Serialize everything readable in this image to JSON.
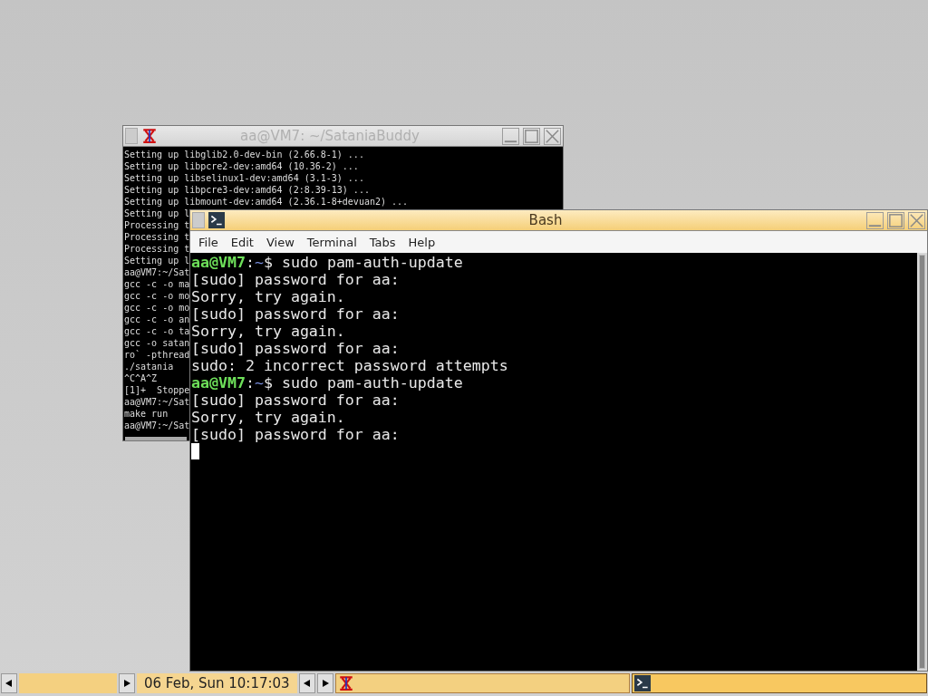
{
  "windows": [
    {
      "title": "aa@VM7: ~/SataniaBuddy",
      "active": false,
      "kind": "xterm",
      "lines": [
        {
          "kind": "output",
          "text": "Setting up libglib2.0-dev-bin (2.66.8-1) ..."
        },
        {
          "kind": "output",
          "text": "Setting up libpcre2-dev:amd64 (10.36-2) ..."
        },
        {
          "kind": "output",
          "text": "Setting up libselinux1-dev:amd64 (3.1-3) ..."
        },
        {
          "kind": "output",
          "text": "Setting up libpcre3-dev:amd64 (2:8.39-13) ..."
        },
        {
          "kind": "output",
          "text": "Setting up libmount-dev:amd64 (2.36.1-8+devuan2) ..."
        },
        {
          "kind": "output",
          "text": "Setting up l"
        },
        {
          "kind": "output",
          "text": "Processing t"
        },
        {
          "kind": "output",
          "text": "Processing t"
        },
        {
          "kind": "output",
          "text": "Processing t"
        },
        {
          "kind": "output",
          "text": "Setting up l"
        },
        {
          "kind": "output",
          "text": "aa@VM7:~/Sat"
        },
        {
          "kind": "output",
          "text": "gcc -c -o ma"
        },
        {
          "kind": "output",
          "text": "gcc -c -o mo"
        },
        {
          "kind": "output",
          "text": "gcc -c -o mo"
        },
        {
          "kind": "output",
          "text": "gcc -c -o an"
        },
        {
          "kind": "output",
          "text": "gcc -c -o ta"
        },
        {
          "kind": "output",
          "text": "gcc -o satan"
        },
        {
          "kind": "output",
          "text": "ro` -pthread"
        },
        {
          "kind": "output",
          "text": "./satania"
        },
        {
          "kind": "output",
          "text": "^C^A^Z"
        },
        {
          "kind": "output",
          "text": "[1]+  Stoppe"
        },
        {
          "kind": "output",
          "text": "aa@VM7:~/Sat"
        },
        {
          "kind": "output",
          "text": "make run"
        },
        {
          "kind": "output",
          "text": "aa@VM7:~/Sat"
        }
      ]
    },
    {
      "title": "Bash",
      "active": true,
      "kind": "terminal",
      "menu": [
        "File",
        "Edit",
        "View",
        "Terminal",
        "Tabs",
        "Help"
      ],
      "lines": [
        {
          "kind": "prompt",
          "user": "aa@VM7",
          "sep": ":",
          "path": "~",
          "symbol": "$",
          "command": "sudo pam-auth-update"
        },
        {
          "kind": "output",
          "text": "[sudo] password for aa:"
        },
        {
          "kind": "output",
          "text": "Sorry, try again."
        },
        {
          "kind": "output",
          "text": "[sudo] password for aa:"
        },
        {
          "kind": "output",
          "text": "Sorry, try again."
        },
        {
          "kind": "output",
          "text": "[sudo] password for aa:"
        },
        {
          "kind": "output",
          "text": "sudo: 2 incorrect password attempts"
        },
        {
          "kind": "prompt",
          "user": "aa@VM7",
          "sep": ":",
          "path": "~",
          "symbol": "$",
          "command": "sudo pam-auth-update"
        },
        {
          "kind": "output",
          "text": "[sudo] password for aa:"
        },
        {
          "kind": "output",
          "text": "Sorry, try again."
        },
        {
          "kind": "output",
          "text": "[sudo] password for aa:"
        },
        {
          "kind": "cursor"
        }
      ]
    }
  ],
  "taskbar": {
    "clock": "06 Feb, Sun 10:17:03",
    "tasks": [
      {
        "kind": "xterm",
        "active": false
      },
      {
        "kind": "terminal",
        "active": true
      }
    ]
  }
}
